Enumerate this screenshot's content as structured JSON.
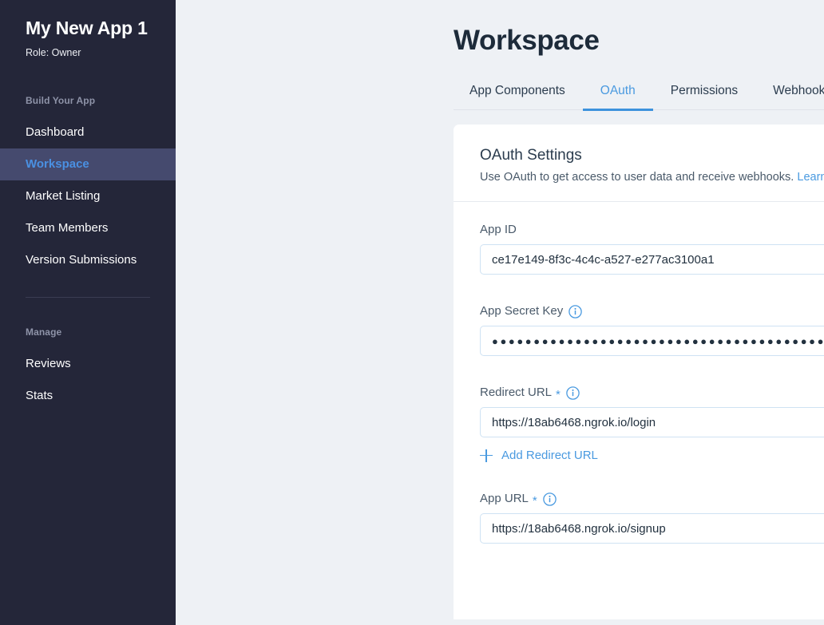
{
  "sidebar": {
    "app_title": "My New App 1",
    "role": "Role: Owner",
    "build_section_label": "Build Your App",
    "build_items": [
      {
        "label": "Dashboard",
        "active": false
      },
      {
        "label": "Workspace",
        "active": true
      },
      {
        "label": "Market Listing",
        "active": false
      },
      {
        "label": "Team Members",
        "active": false
      },
      {
        "label": "Version Submissions",
        "active": false
      }
    ],
    "manage_section_label": "Manage",
    "manage_items": [
      {
        "label": "Reviews",
        "active": false
      },
      {
        "label": "Stats",
        "active": false
      }
    ],
    "bg_color": "#242639",
    "active_bg_color": "#454a6e",
    "active_text_color": "#4a90e2"
  },
  "header": {
    "title": "Workspace"
  },
  "tabs": [
    {
      "label": "App Components",
      "active": false
    },
    {
      "label": "OAuth",
      "active": true
    },
    {
      "label": "Permissions",
      "active": false
    },
    {
      "label": "Webhooks",
      "active": false
    }
  ],
  "card": {
    "title": "OAuth Settings",
    "subtitle": "Use OAuth to get access to user data and receive webhooks.",
    "learn_more_label": "Learn more"
  },
  "fields": {
    "app_id": {
      "label": "App ID",
      "value": "ce17e149-8f3c-4c4c-a527-e277ac3100a1",
      "placeholder": "",
      "clear_label": "×",
      "required": false,
      "has_info": false
    },
    "app_secret_key": {
      "label": "App Secret Key",
      "value": "●●●●●●●●●●●●●●●●●●●●●●●●●●●●●●●●●●●●●●●●",
      "placeholder": "",
      "required": false,
      "has_info": true
    },
    "redirect_url": {
      "label": "Redirect URL",
      "value": "https://18ab6468.ngrok.io/login",
      "placeholder": "",
      "clear_label": "×",
      "required": true,
      "required_marker": "*",
      "has_info": true,
      "add_link_label": "Add Redirect URL"
    },
    "app_url": {
      "label": "App URL",
      "value": "https://18ab6468.ngrok.io/signup",
      "placeholder": "",
      "clear_label": "×",
      "required": true,
      "required_marker": "*",
      "has_info": true
    }
  },
  "colors": {
    "accent": "#4a9ae0",
    "tab_underline": "#3d92dd",
    "page_bg": "#eef1f5",
    "card_bg": "#ffffff",
    "input_border": "#cfe2f3",
    "text_dark": "#22313f"
  }
}
